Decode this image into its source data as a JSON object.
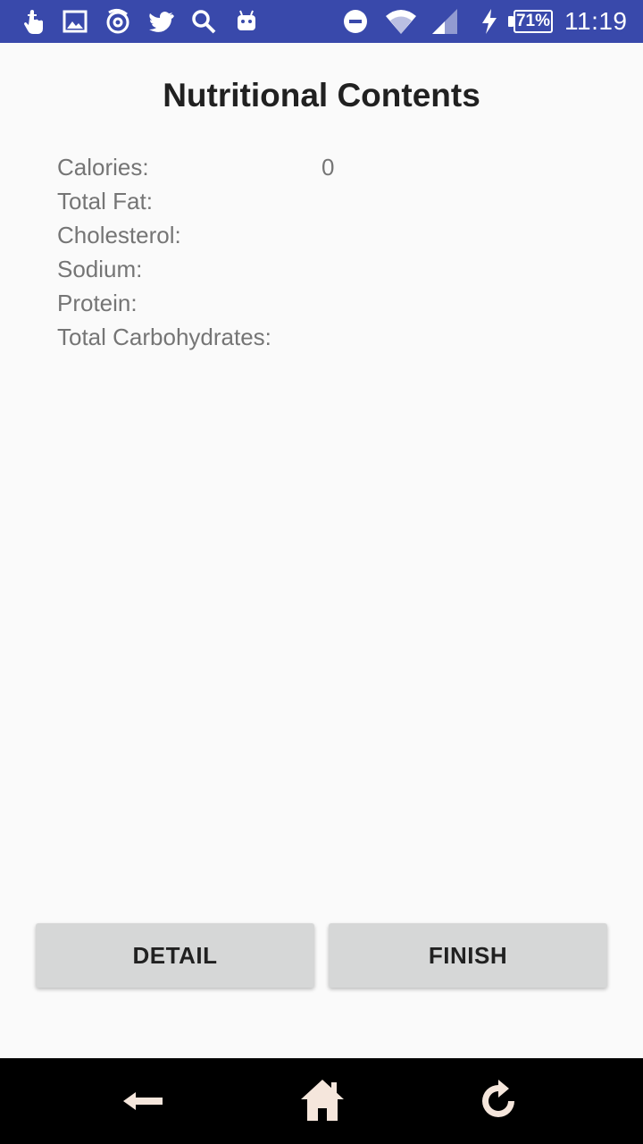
{
  "status_bar": {
    "icons_left": [
      "touch-icon",
      "gallery-icon",
      "app-icon",
      "twitter-icon",
      "search-icon",
      "android-icon"
    ],
    "icons_right": [
      "do-not-disturb-icon",
      "wifi-icon",
      "signal-icon",
      "charging-icon"
    ],
    "battery": "71%",
    "time": "11:19",
    "color": "#3949ab"
  },
  "page": {
    "title": "Nutritional Contents"
  },
  "nutrition": [
    {
      "label": "Calories:",
      "value": "0"
    },
    {
      "label": "Total Fat:",
      "value": ""
    },
    {
      "label": "Cholesterol:",
      "value": ""
    },
    {
      "label": "Sodium:",
      "value": ""
    },
    {
      "label": "Protein:",
      "value": ""
    },
    {
      "label": "Total Carbohydrates:",
      "value": ""
    }
  ],
  "buttons": {
    "detail": "DETAIL",
    "finish": "FINISH"
  },
  "nav_bar": {
    "icons": [
      "back-arrow-icon",
      "home-icon",
      "refresh-icon"
    ]
  }
}
